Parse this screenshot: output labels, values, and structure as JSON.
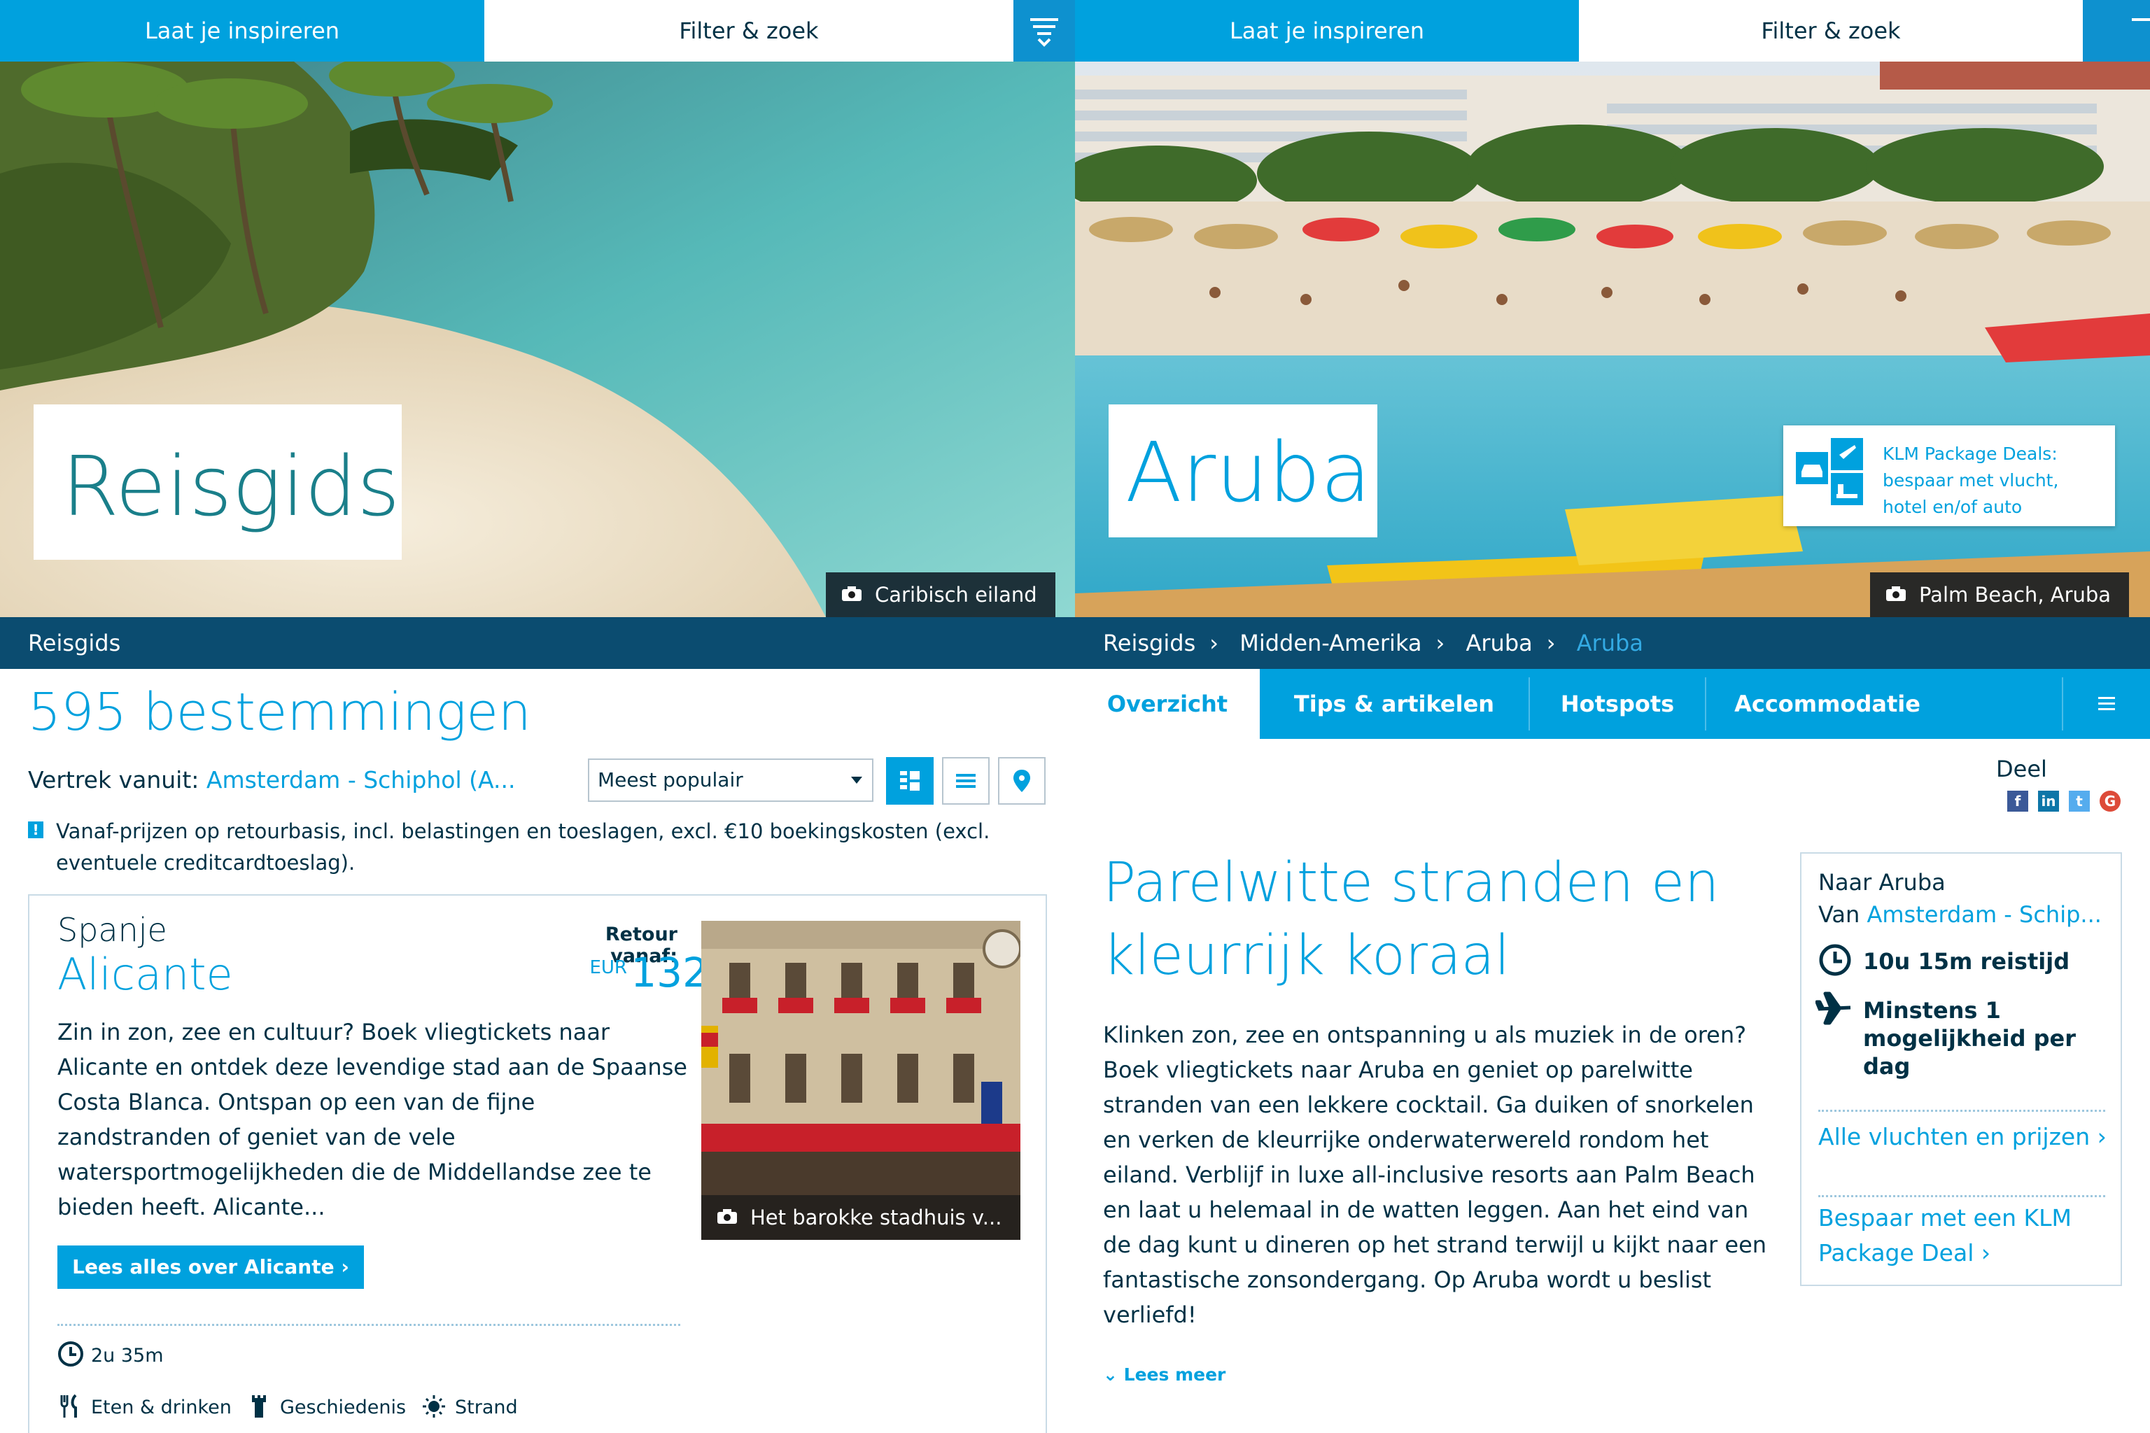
{
  "left": {
    "nav": {
      "inspire": "Laat je inspireren",
      "filter": "Filter & zoek"
    },
    "hero": {
      "title": "Reisgids",
      "caption": "Caribisch eiland"
    },
    "breadcrumb": "Reisgids",
    "results": {
      "title": "595 bestemmingen",
      "vertrek_label": "Vertrek vanuit:",
      "vertrek_value": "Amsterdam - Schiphol (A...",
      "sort_selected": "Meest populair",
      "notice": "Vanaf-prijzen op retourbasis, incl. belastingen en toeslagen, excl. €10 boekingskosten (excl. eventuele creditcardtoeslag)."
    },
    "card": {
      "country": "Spanje",
      "city": "Alicante",
      "price_label": "Retour vanaf:",
      "currency": "EUR",
      "price": "132",
      "photo_caption": "Het barokke stadhuis v...",
      "description": "Zin in zon, zee en cultuur? Boek vliegtickets naar Alicante en ontdek deze levendige stad aan de Spaanse Costa Blanca. Ontspan op een van de fijne zandstranden of geniet van de vele watersportmogelijkheden die de Middellandse zee te bieden heeft. Alicante...",
      "button": "Lees alles over Alicante ›",
      "duration": "2u 35m",
      "tags": [
        "Eten & drinken",
        "Geschiedenis",
        "Strand"
      ]
    }
  },
  "right": {
    "nav": {
      "inspire": "Laat je inspireren",
      "filter": "Filter & zoek"
    },
    "hero": {
      "title": "Aruba",
      "caption": "Palm Beach, Aruba",
      "package_text": "KLM Package Deals: bespaar met vlucht, hotel en/of auto"
    },
    "breadcrumb": [
      "Reisgids",
      "Midden-Amerika",
      "Aruba",
      "Aruba"
    ],
    "tabs": [
      "Overzicht",
      "Tips & artikelen",
      "Hotspots",
      "Accommodatie"
    ],
    "share_label": "Deel",
    "article": {
      "title": "Parelwitte stranden en kleurrijk koraal",
      "body": "Klinken zon, zee en ontspanning u als muziek in de oren? Boek vliegtickets naar Aruba en geniet op parelwitte stranden van een lekkere cocktail. Ga duiken of snorkelen en verken de kleurrijke onderwaterwereld rondom het eiland. Verblijf in luxe all-inclusive resorts aan Palm Beach en laat u helemaal in de watten leggen. Aan het eind van de dag kunt u dineren op het strand terwijl u kijkt naar een fantastische zonsondergang. Op Aruba wordt u beslist verliefd!",
      "read_more": "Lees meer"
    },
    "infobox": {
      "heading": "Naar Aruba",
      "from_label": "Van",
      "from_value": "Amsterdam - Schip...",
      "travel_time": "10u 15m reistijd",
      "frequency": "Minstens 1 mogelijkheid per dag",
      "link_flights": "Alle vluchten en prijzen ›",
      "link_package": "Bespaar met een KLM Package Deal ›"
    }
  },
  "colors": {
    "accent": "#00a1de",
    "dark": "#003145",
    "crumb_bar": "#0b4c70"
  }
}
